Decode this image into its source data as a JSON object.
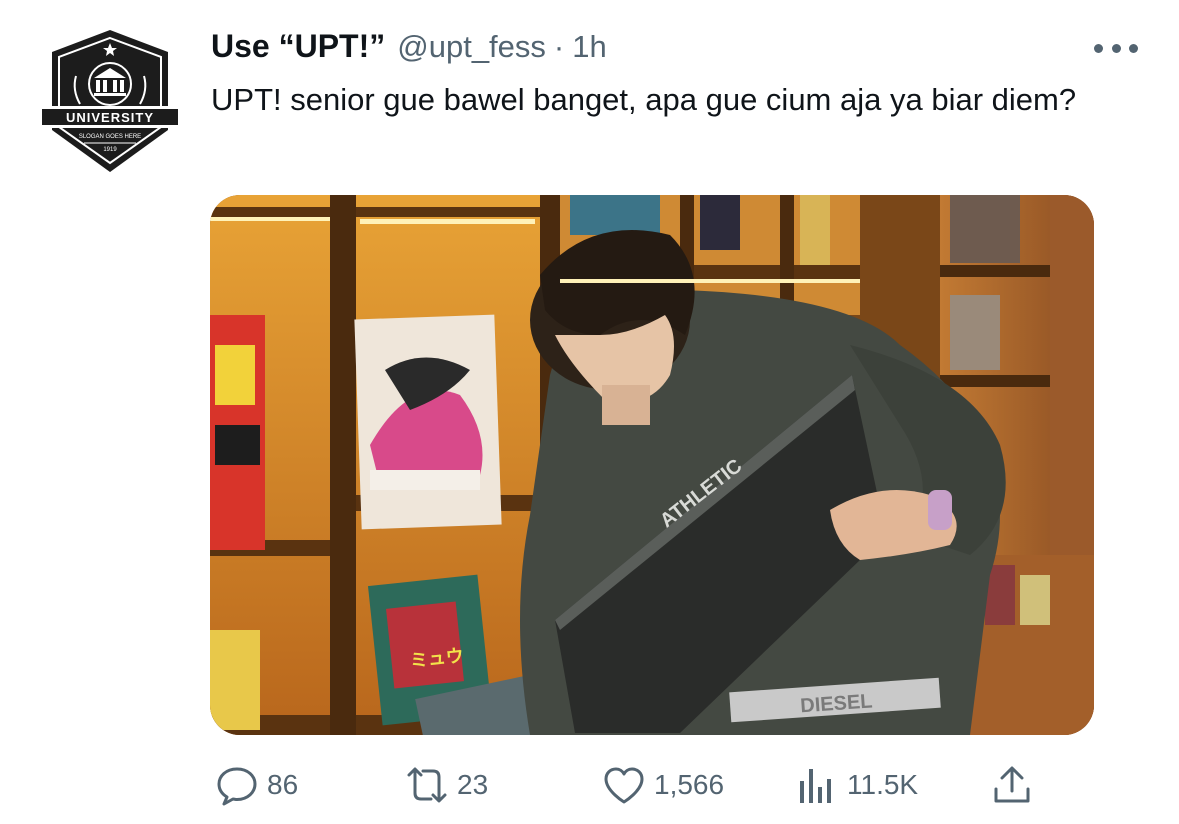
{
  "tweet": {
    "display_name": "Use “UPT!”",
    "handle": "@upt_fess",
    "separator": "·",
    "time": "1h",
    "text": "UPT! senior gue bawel banget, apa gue cium aja ya biar diem?"
  },
  "avatar": {
    "logo_text": "UNIVERSITY",
    "slogan": "SLOGAN GOES HERE",
    "year": "1919"
  },
  "media": {
    "shirt_text": "ATHLETIC",
    "waistband_text": "DIESEL",
    "record_text": "ミュウ"
  },
  "actions": {
    "replies": {
      "icon": "reply-icon",
      "count": "86"
    },
    "retweets": {
      "icon": "retweet-icon",
      "count": "23"
    },
    "likes": {
      "icon": "like-icon",
      "count": "1,566"
    },
    "views": {
      "icon": "views-icon",
      "count": "11.5K"
    },
    "share": {
      "icon": "share-icon"
    }
  },
  "colors": {
    "text": "#0f1419",
    "secondary": "#536471",
    "avatar_badge": "#1c1c1c"
  }
}
